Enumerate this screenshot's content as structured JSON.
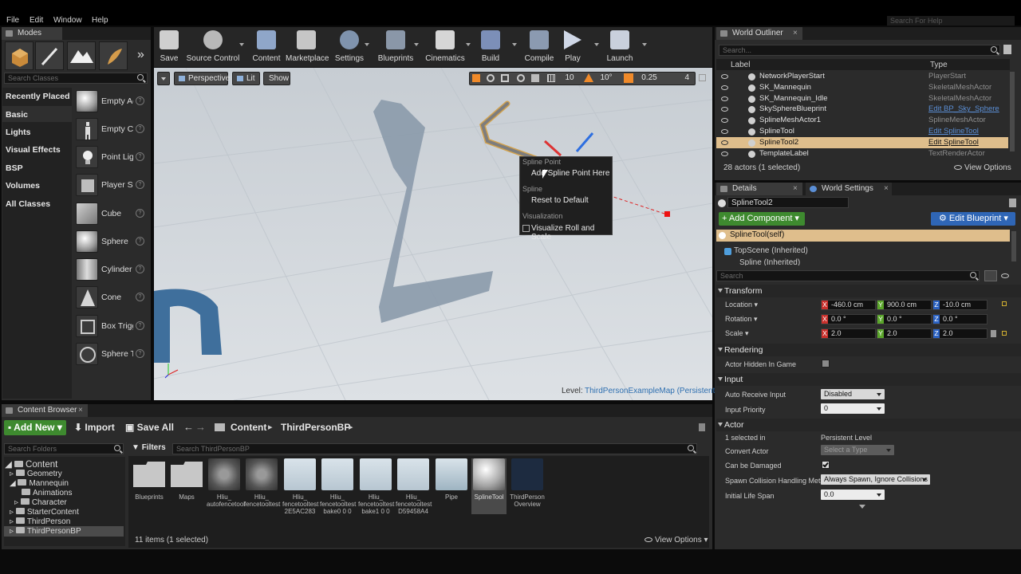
{
  "menu": {
    "file": "File",
    "edit": "Edit",
    "window": "Window",
    "help": "Help",
    "search_help_placeholder": "Search For Help"
  },
  "modes": {
    "tab": "Modes",
    "search_placeholder": "Search Classes",
    "categories": [
      "Recently Placed",
      "Basic",
      "Lights",
      "Visual Effects",
      "BSP",
      "Volumes",
      "All Classes"
    ],
    "selected_category": "Basic",
    "items": [
      "Empty Ac",
      "Empty Ch",
      "Point Ligl",
      "Player St",
      "Cube",
      "Sphere",
      "Cylinder",
      "Cone",
      "Box Trigg",
      "Sphere T"
    ]
  },
  "toolbar": {
    "buttons": [
      "Save",
      "Source Control",
      "Content",
      "Marketplace",
      "Settings",
      "Blueprints",
      "Cinematics",
      "Build",
      "Compile",
      "Play",
      "Launch"
    ]
  },
  "viewport": {
    "perspective": "Perspective",
    "lit": "Lit",
    "show": "Show",
    "grid_size": "10",
    "rot_snap": "10°",
    "scale_snap": "0.25",
    "cam_speed": "4",
    "level_label": "Level:",
    "level_name": "ThirdPersonExampleMap (Persistent)"
  },
  "context_menu": {
    "section1": "Spline Point",
    "item1": "Add Spline Point Here",
    "section2": "Spline",
    "item2": "Reset to Default",
    "section3": "Visualization",
    "item3": "Visualize Roll and Scale"
  },
  "outliner": {
    "tab": "World Outliner",
    "search_placeholder": "Search...",
    "col_label": "Label",
    "col_type": "Type",
    "rows": [
      {
        "name": "NetworkPlayerStart",
        "type": "PlayerStart"
      },
      {
        "name": "SK_Mannequin",
        "type": "SkeletalMeshActor"
      },
      {
        "name": "SK_Mannequin_Idle",
        "type": "SkeletalMeshActor"
      },
      {
        "name": "SkySphereBlueprint",
        "type": "Edit BP_Sky_Sphere"
      },
      {
        "name": "SplineMeshActor1",
        "type": "SplineMeshActor"
      },
      {
        "name": "SplineTool",
        "type": "Edit SplineTool"
      },
      {
        "name": "SplineTool2",
        "type": "Edit SplineTool"
      },
      {
        "name": "TemplateLabel",
        "type": "TextRenderActor"
      }
    ],
    "status": "28 actors (1 selected)",
    "view_options": "View Options"
  },
  "details": {
    "tab": "Details",
    "tab2": "World Settings",
    "name_value": "SplineTool2",
    "add_component": "+ Add Component",
    "edit_blueprint": "Edit Blueprint",
    "components": [
      "SplineTool(self)",
      "TopScene (Inherited)",
      "Spline (Inherited)"
    ],
    "search_placeholder": "Search",
    "transform": "Transform",
    "location": "Location",
    "rotation": "Rotation",
    "scale": "Scale",
    "loc": [
      "-460.0 cm",
      "900.0 cm",
      "-10.0 cm"
    ],
    "rot": [
      "0.0 °",
      "0.0 °",
      "0.0 °"
    ],
    "scl": [
      "2.0",
      "2.0",
      "2.0"
    ],
    "rendering": "Rendering",
    "hidden_in_game": "Actor Hidden In Game",
    "input": "Input",
    "auto_receive_input": "Auto Receive Input",
    "auto_receive_value": "Disabled",
    "input_priority": "Input Priority",
    "input_priority_value": "0",
    "actor": "Actor",
    "selected_in": "1 selected in",
    "selected_in_value": "Persistent Level",
    "convert_actor": "Convert Actor",
    "convert_actor_value": "Select a Type",
    "can_be_damaged": "Can be Damaged",
    "spawn_collision": "Spawn Collision Handling Meth",
    "spawn_collision_value": "Always Spawn, Ignore Collisions",
    "initial_life_span": "Initial Life Span",
    "initial_life_span_value": "0.0"
  },
  "content_browser": {
    "tab": "Content Browser",
    "add_new": "Add New",
    "import": "Import",
    "save_all": "Save All",
    "path": [
      "Content",
      "ThirdPersonBP"
    ],
    "search_folders": "Search Folders",
    "filters": "Filters",
    "search_assets": "Search ThirdPersonBP",
    "tree": [
      "Content",
      "Geometry",
      "Mannequin",
      "Animations",
      "Character",
      "StarterContent",
      "ThirdPerson",
      "ThirdPersonBP"
    ],
    "assets": [
      "Blueprints",
      "Maps",
      "Hliu_ autofencetool",
      "Hliu_ fencetooltest",
      "Hliu_ fencetooltest 2E5AC283",
      "Hliu_ fencetooltest bake0 0 0",
      "Hliu_ fencetooltest bake1 0 0",
      "Hliu_ fencetooltest D59458A4",
      "Pipe",
      "SplineTool",
      "ThirdPerson Overview"
    ],
    "status": "11 items (1 selected)",
    "view_options": "View Options"
  }
}
